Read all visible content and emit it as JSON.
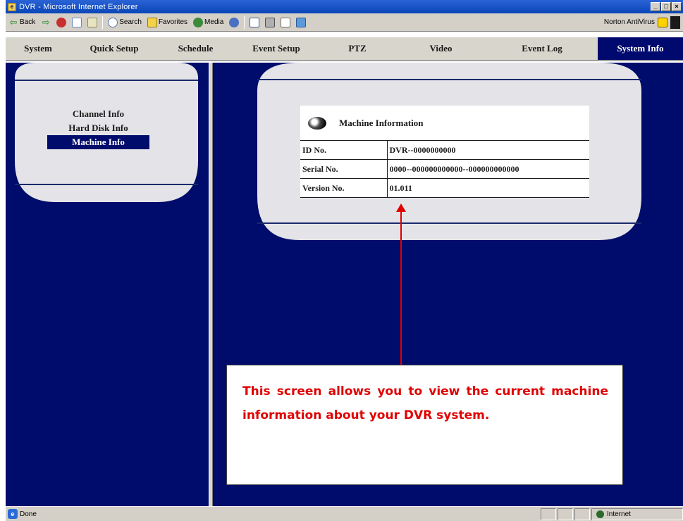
{
  "window": {
    "title": "DVR - Microsoft Internet Explorer",
    "controls": [
      "_",
      "□",
      "×"
    ]
  },
  "toolbar": {
    "back_label": "Back",
    "search_label": "Search",
    "favorites_label": "Favorites",
    "media_label": "Media",
    "norton_label": "Norton AntiVirus"
  },
  "nav": {
    "items": [
      {
        "label": "System"
      },
      {
        "label": "Quick Setup"
      },
      {
        "label": "Schedule"
      },
      {
        "label": "Event Setup"
      },
      {
        "label": "PTZ"
      },
      {
        "label": "Video"
      },
      {
        "label": "Event Log"
      },
      {
        "label": "System Info",
        "active": true
      }
    ]
  },
  "side_menu": {
    "items": [
      {
        "label": "Channel Info"
      },
      {
        "label": "Hard Disk Info"
      },
      {
        "label": "Machine Info",
        "selected": true
      }
    ]
  },
  "machine_info": {
    "title": "Machine Information",
    "rows": [
      {
        "label": "ID No.",
        "value": "DVR--0000000000"
      },
      {
        "label": "Serial No.",
        "value": "0000--000000000000--000000000000"
      },
      {
        "label": "Version No.",
        "value": "01.011"
      }
    ]
  },
  "annotation": {
    "text": "This screen allows you to view the current machine information about your DVR system."
  },
  "status": {
    "left_text": "Done",
    "zone_text": "Internet"
  },
  "colors": {
    "dvr_background": "#000c6b",
    "panel_gray": "#e4e4e8",
    "annotation_red": "#e00000",
    "nav_active": "#000a6e"
  }
}
